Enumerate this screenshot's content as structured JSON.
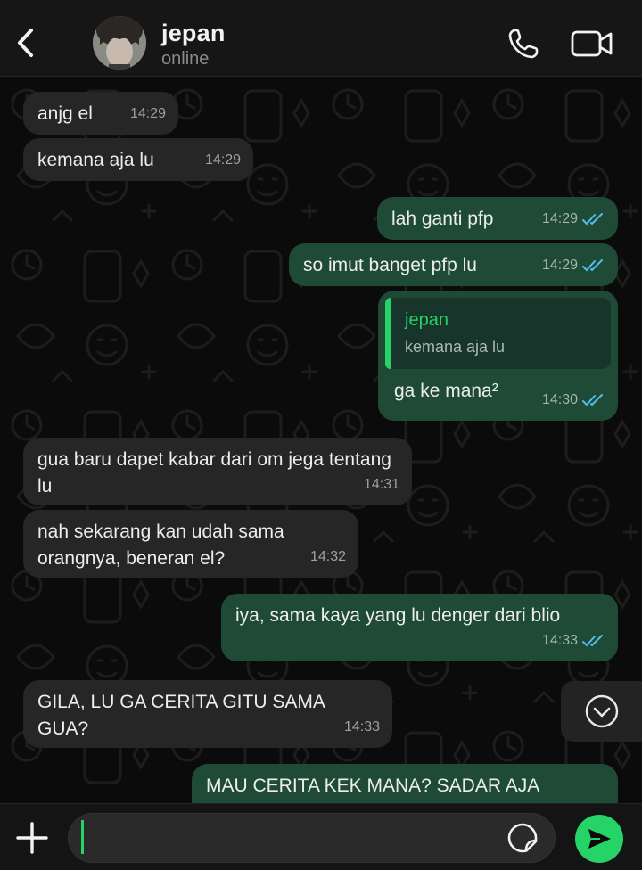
{
  "header": {
    "contact_name": "jepan",
    "status": "online",
    "back_icon": "chevron-left-icon",
    "call_icon": "phone-icon",
    "video_icon": "video-camera-icon"
  },
  "messages": [
    {
      "direction": "in",
      "text": "anjg el",
      "time": "14:29"
    },
    {
      "direction": "in",
      "text": "kemana aja lu",
      "time": "14:29"
    },
    {
      "direction": "out",
      "text": "lah ganti pfp",
      "time": "14:29",
      "status": "read"
    },
    {
      "direction": "out",
      "text": "so imut banget pfp lu",
      "time": "14:29",
      "status": "read"
    },
    {
      "direction": "out",
      "text": "ga ke mana²",
      "time": "14:30",
      "status": "read",
      "reply_to": {
        "name": "jepan",
        "text": "kemana aja lu"
      }
    },
    {
      "direction": "in",
      "text": "gua baru dapet kabar dari om jega tentang lu",
      "time": "14:31"
    },
    {
      "direction": "in",
      "text": "nah sekarang kan udah sama orangnya, beneran el?",
      "time": "14:32"
    },
    {
      "direction": "out",
      "text": "iya, sama kaya yang lu denger dari blio",
      "time": "14:33",
      "status": "read"
    },
    {
      "direction": "in",
      "text": "GILA, LU GA CERITA GITU SAMA GUA?",
      "time": "14:33"
    },
    {
      "direction": "out",
      "text": "MAU CERITA KEK MANA? SADAR AJA"
    }
  ],
  "input": {
    "value": "",
    "placeholder": ""
  },
  "colors": {
    "accent": "#25d366",
    "incoming_bubble": "#262626",
    "outgoing_bubble": "#1e4a36",
    "read_ticks": "#53bdeb"
  }
}
